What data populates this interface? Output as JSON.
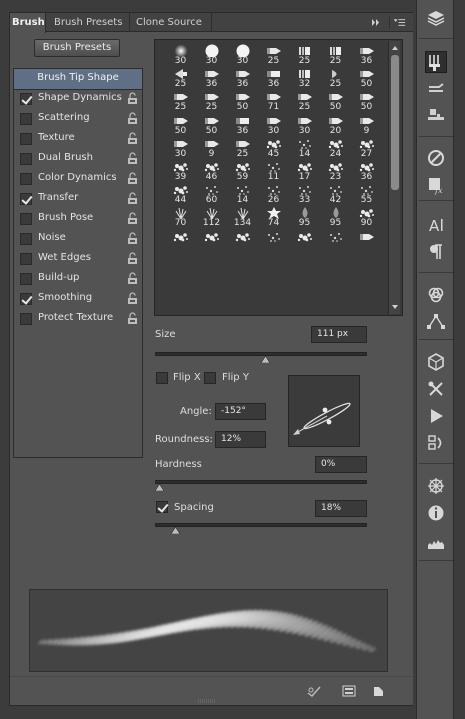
{
  "tabs": [
    {
      "label": "Brush",
      "active": true
    },
    {
      "label": "Brush Presets",
      "active": false
    },
    {
      "label": "Clone Source",
      "active": false
    }
  ],
  "brush_presets_button": "Brush Presets",
  "left_options": [
    {
      "label": "Brush Tip Shape",
      "selected": true,
      "has_checkbox": false,
      "checked": false,
      "lock": false
    },
    {
      "label": "Shape Dynamics",
      "has_checkbox": true,
      "checked": true,
      "lock": true
    },
    {
      "label": "Scattering",
      "has_checkbox": true,
      "checked": false,
      "lock": true
    },
    {
      "label": "Texture",
      "has_checkbox": true,
      "checked": false,
      "lock": true
    },
    {
      "label": "Dual Brush",
      "has_checkbox": true,
      "checked": false,
      "lock": true
    },
    {
      "label": "Color Dynamics",
      "has_checkbox": true,
      "checked": false,
      "lock": true
    },
    {
      "label": "Transfer",
      "has_checkbox": true,
      "checked": true,
      "lock": true
    },
    {
      "label": "Brush Pose",
      "has_checkbox": true,
      "checked": false,
      "lock": true
    },
    {
      "label": "Noise",
      "has_checkbox": true,
      "checked": false,
      "lock": true
    },
    {
      "label": "Wet Edges",
      "has_checkbox": true,
      "checked": false,
      "lock": true
    },
    {
      "label": "Build-up",
      "has_checkbox": true,
      "checked": false,
      "lock": true
    },
    {
      "label": "Smoothing",
      "has_checkbox": true,
      "checked": true,
      "lock": true
    },
    {
      "label": "Protect Texture",
      "has_checkbox": true,
      "checked": false,
      "lock": true
    }
  ],
  "brush_tips": [
    {
      "size": "30",
      "shape": "soft"
    },
    {
      "size": "30",
      "shape": "hard"
    },
    {
      "size": "30",
      "shape": "hard"
    },
    {
      "size": "25",
      "shape": "pencil"
    },
    {
      "size": "25",
      "shape": "bristle"
    },
    {
      "size": "25",
      "shape": "bristle"
    },
    {
      "size": "36",
      "shape": "pencil"
    },
    {
      "size": "25",
      "shape": "fan"
    },
    {
      "size": "36",
      "shape": "pencil"
    },
    {
      "size": "36",
      "shape": "pencil"
    },
    {
      "size": "36",
      "shape": "flat"
    },
    {
      "size": "32",
      "shape": "bristle"
    },
    {
      "size": "25",
      "shape": "round"
    },
    {
      "size": "50",
      "shape": "pencil"
    },
    {
      "size": "25",
      "shape": "pencil"
    },
    {
      "size": "25",
      "shape": "pencil"
    },
    {
      "size": "50",
      "shape": "pencil"
    },
    {
      "size": "71",
      "shape": "pencil"
    },
    {
      "size": "25",
      "shape": "pencil"
    },
    {
      "size": "50",
      "shape": "pencil"
    },
    {
      "size": "50",
      "shape": "pencil"
    },
    {
      "size": "50",
      "shape": "pencil"
    },
    {
      "size": "50",
      "shape": "pencil"
    },
    {
      "size": "36",
      "shape": "flat"
    },
    {
      "size": "30",
      "shape": "pencil"
    },
    {
      "size": "30",
      "shape": "pencil"
    },
    {
      "size": "20",
      "shape": "pencil"
    },
    {
      "size": "9",
      "shape": "pencil"
    },
    {
      "size": "30",
      "shape": "pencil"
    },
    {
      "size": "9",
      "shape": "pencil"
    },
    {
      "size": "25",
      "shape": "pencil"
    },
    {
      "size": "45",
      "shape": "splat"
    },
    {
      "size": "14",
      "shape": "dots"
    },
    {
      "size": "24",
      "shape": "splat"
    },
    {
      "size": "27",
      "shape": "splat"
    },
    {
      "size": "39",
      "shape": "splat"
    },
    {
      "size": "46",
      "shape": "splat"
    },
    {
      "size": "59",
      "shape": "splat"
    },
    {
      "size": "11",
      "shape": "dots"
    },
    {
      "size": "17",
      "shape": "splat"
    },
    {
      "size": "23",
      "shape": "splat"
    },
    {
      "size": "36",
      "shape": "splat"
    },
    {
      "size": "44",
      "shape": "splat"
    },
    {
      "size": "60",
      "shape": "dots"
    },
    {
      "size": "14",
      "shape": "dots"
    },
    {
      "size": "26",
      "shape": "dots"
    },
    {
      "size": "33",
      "shape": "dots"
    },
    {
      "size": "42",
      "shape": "dots"
    },
    {
      "size": "55",
      "shape": "dots"
    },
    {
      "size": "70",
      "shape": "grass"
    },
    {
      "size": "112",
      "shape": "grass"
    },
    {
      "size": "134",
      "shape": "grass"
    },
    {
      "size": "74",
      "shape": "leaf"
    },
    {
      "size": "95",
      "shape": "drop"
    },
    {
      "size": "95",
      "shape": "drop"
    },
    {
      "size": "90",
      "shape": "splat"
    },
    {
      "size": "",
      "shape": "splat"
    },
    {
      "size": "",
      "shape": "splat"
    },
    {
      "size": "",
      "shape": "splat"
    },
    {
      "size": "",
      "shape": "dots"
    },
    {
      "size": "",
      "shape": "splat"
    },
    {
      "size": "",
      "shape": "dots"
    },
    {
      "size": "",
      "shape": "pencil"
    }
  ],
  "size": {
    "label": "Size",
    "value": "111 px",
    "fraction": 0.52
  },
  "flip_x": {
    "label": "Flip X",
    "checked": false
  },
  "flip_y": {
    "label": "Flip Y",
    "checked": false
  },
  "angle": {
    "label": "Angle:",
    "value": "-152°"
  },
  "roundness": {
    "label": "Roundness:",
    "value": "12%"
  },
  "hardness": {
    "label": "Hardness",
    "value": "0%",
    "fraction": 0.0
  },
  "spacing": {
    "label": "Spacing",
    "value": "18%",
    "checked": true,
    "fraction": 0.08
  },
  "colors": {
    "panel": "#535353",
    "selected": "#5e6f86",
    "field": "#3a3a3a"
  },
  "right_toolbar_icons": [
    "layers-icon",
    "brush-icon",
    "brush-presets-icon",
    "clone-source-icon",
    "color-icon",
    "styles-icon",
    "character-icon",
    "paragraph-icon",
    "channels-icon",
    "paths-icon",
    "3d-icon",
    "adjustments-icon",
    "actions-icon",
    "history-icon",
    "navigator-icon",
    "info-icon",
    "histogram-icon"
  ]
}
